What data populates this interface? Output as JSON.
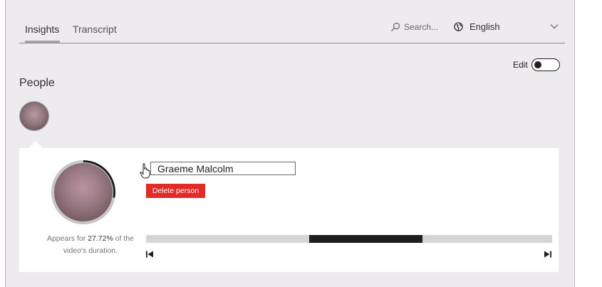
{
  "tabs": [
    {
      "label": "Insights",
      "active": true
    },
    {
      "label": "Transcript",
      "active": false
    }
  ],
  "search": {
    "placeholder": "Search..."
  },
  "language": {
    "selected": "English"
  },
  "edit": {
    "label": "Edit",
    "enabled": false
  },
  "people": {
    "title": "People",
    "selected_person": {
      "name": "Graeme Malcolm",
      "delete_label": "Delete person",
      "appears_prefix": "Appears for ",
      "appears_percent": "27.72%",
      "appears_suffix": " of the",
      "appears_line2": "video's duration.",
      "appearance_fraction": 0.2772,
      "timeline_segments": [
        {
          "start": 0.402,
          "end": 0.68
        }
      ]
    }
  },
  "icons": {
    "search": "search-icon",
    "language": "globe-icon",
    "chevron": "chevron-down-icon",
    "cursor": "hand-pointer-icon",
    "prev": "skip-previous-icon",
    "next": "skip-next-icon"
  },
  "colors": {
    "delete": "#e02b27",
    "timeline_fill": "#1f1e1e",
    "panel_bg": "#edebee"
  }
}
